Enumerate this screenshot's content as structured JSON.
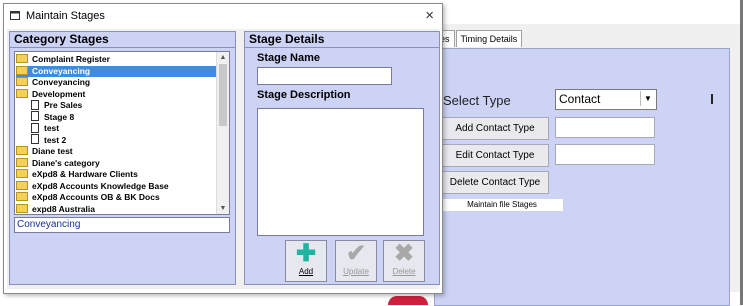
{
  "dialog": {
    "title": "Maintain Stages",
    "close": "×"
  },
  "category_panel": {
    "header": "Category Stages",
    "items": [
      {
        "label": "Complaint Register",
        "kind": "folder",
        "indent": 0,
        "selected": false
      },
      {
        "label": "Conveyancing",
        "kind": "folder",
        "indent": 0,
        "selected": true
      },
      {
        "label": "Conveyancing",
        "kind": "folder",
        "indent": 0,
        "selected": false
      },
      {
        "label": "Development",
        "kind": "folder",
        "indent": 0,
        "selected": false
      },
      {
        "label": "Pre Sales",
        "kind": "doc",
        "indent": 1,
        "selected": false
      },
      {
        "label": "Stage 8",
        "kind": "doc",
        "indent": 1,
        "selected": false
      },
      {
        "label": "test",
        "kind": "doc",
        "indent": 1,
        "selected": false
      },
      {
        "label": "test 2",
        "kind": "doc",
        "indent": 1,
        "selected": false
      },
      {
        "label": "Diane test",
        "kind": "folder",
        "indent": 0,
        "selected": false
      },
      {
        "label": "Diane's category",
        "kind": "folder",
        "indent": 0,
        "selected": false
      },
      {
        "label": "eXpd8 & Hardware Clients",
        "kind": "folder",
        "indent": 0,
        "selected": false
      },
      {
        "label": "eXpd8 Accounts Knowledge Base",
        "kind": "folder",
        "indent": 0,
        "selected": false
      },
      {
        "label": "eXpd8 Accounts OB & BK Docs",
        "kind": "folder",
        "indent": 0,
        "selected": false
      },
      {
        "label": "expd8 Australia",
        "kind": "folder",
        "indent": 0,
        "selected": false
      }
    ],
    "selected_value": "Conveyancing"
  },
  "stage_panel": {
    "header": "Stage Details",
    "name_label": "Stage Name",
    "name_value": "",
    "desc_label": "Stage Description",
    "desc_value": "",
    "buttons": [
      {
        "label": "Add",
        "icon": "plus-icon",
        "enabled": true
      },
      {
        "label": "Update",
        "icon": "check-icon",
        "enabled": false
      },
      {
        "label": "Delete",
        "icon": "x-icon",
        "enabled": false
      }
    ]
  },
  "background_window": {
    "tabs": [
      "pes",
      "Timing Details"
    ],
    "select_type_label": "Select Type",
    "select_type_value": "Contact",
    "add_button": "Add Contact Type",
    "edit_button": "Edit Contact Type",
    "delete_button": "Delete Contact Type",
    "strip_text": "Maintain file Stages"
  },
  "colors": {
    "panel_bg": "#ccd3f5",
    "selection": "#3e8ce0",
    "folder": "#f3d058"
  }
}
